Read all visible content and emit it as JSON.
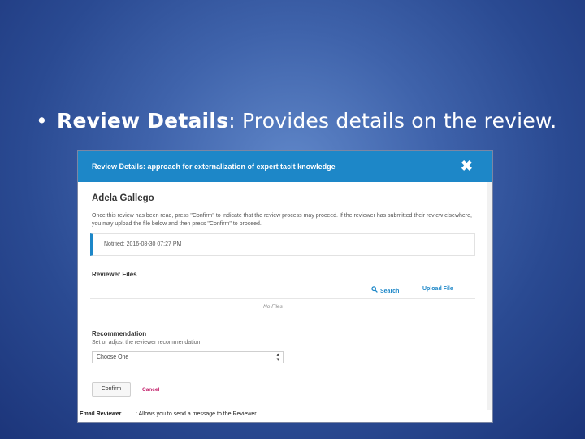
{
  "slide": {
    "bullet_symbol": "•",
    "term": "Review Details",
    "description": ": Provides details on the review."
  },
  "modal": {
    "title": "Review Details: approach for externalization of expert tacit knowledge",
    "close_symbol": "✖",
    "reviewer_name": "Adela Gallego",
    "instructions": "Once this review has been read, press \"Confirm\" to indicate that the review process may proceed. If the reviewer has submitted their review elsewhere, you may upload the file below and then press \"Confirm\" to proceed.",
    "notified": "Notified: 2016-08-30 07:27 PM",
    "reviewer_files": {
      "heading": "Reviewer Files",
      "search_label": "Search",
      "upload_label": "Upload File",
      "empty_text": "No Files"
    },
    "recommendation": {
      "heading": "Recommendation",
      "description": "Set or adjust the reviewer recommendation.",
      "selected": "Choose One",
      "select_arrow": "▴▾"
    },
    "confirm_label": "Confirm",
    "cancel_label": "Cancel"
  },
  "caption": {
    "bold": "Email Reviewer",
    "rest": ": Allows you to send a message to the Reviewer"
  },
  "colors": {
    "header_blue": "#1d87c8",
    "cancel_pink": "#c3206b"
  },
  "icons": {
    "close": "close-icon",
    "search": "search-icon"
  }
}
